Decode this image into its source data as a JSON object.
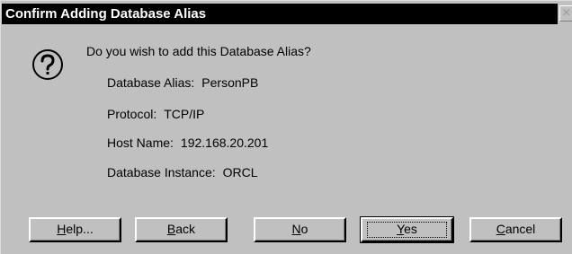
{
  "dialog": {
    "title": "Confirm Adding Database Alias",
    "close_glyph": "×",
    "prompt": "Do you wish to add this Database Alias?",
    "icon": "question-icon"
  },
  "details": [
    {
      "label": "Database Alias:",
      "value": "PersonPB"
    },
    {
      "label": "Protocol:",
      "value": "TCP/IP"
    },
    {
      "label": "Host Name:",
      "value": "192.168.20.201"
    },
    {
      "label": "Database Instance:",
      "value": "ORCL"
    }
  ],
  "buttons": {
    "help": {
      "mnemonic": "H",
      "rest": "elp..."
    },
    "back": {
      "mnemonic": "B",
      "rest": "ack"
    },
    "no": {
      "mnemonic": "N",
      "rest": "o"
    },
    "yes": {
      "mnemonic": "Y",
      "rest": "es"
    },
    "cancel": {
      "mnemonic": "C",
      "rest": "ancel"
    }
  }
}
